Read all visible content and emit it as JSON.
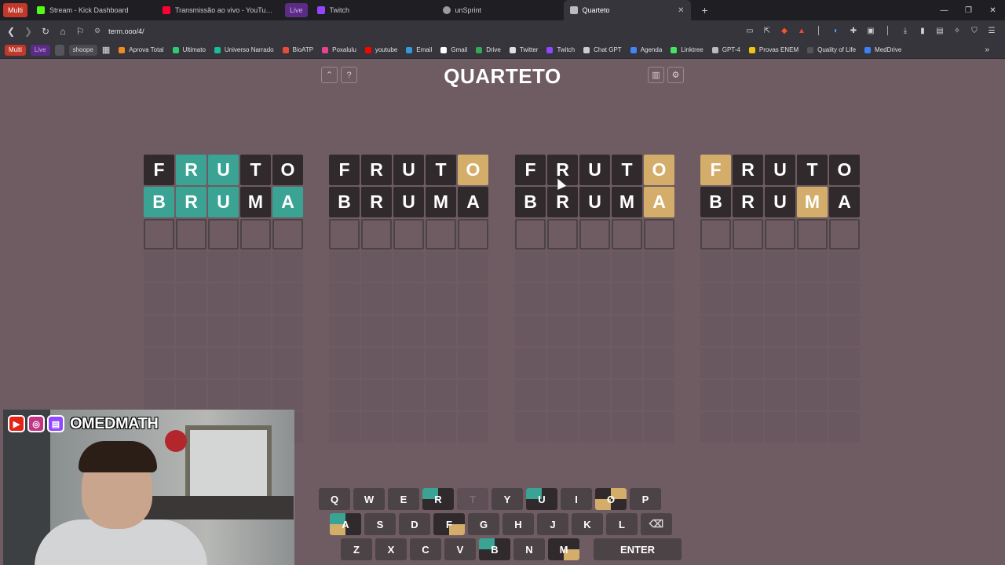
{
  "browser": {
    "multi_label": "Multi",
    "tabs": [
      {
        "label": "Stream - Kick Dashboard",
        "fav": "#53fc18"
      },
      {
        "label": "Transmissão ao vivo - YouTube Studio",
        "fav": "#ff0033"
      },
      {
        "label": "Twitch",
        "fav": "#9146ff"
      },
      {
        "label": "unSprint",
        "fav": "#9a9aa0"
      },
      {
        "label": "Quarteto",
        "fav": "#bbbbbb"
      }
    ],
    "live_label": "Live",
    "new_tab": "+",
    "url": "term.ooo/4/",
    "bookmarks_pills": [
      "Multi",
      "Live",
      "shoope"
    ],
    "bookmarks": [
      {
        "label": "Aprova Total",
        "color": "#f08a24"
      },
      {
        "label": "Ultimato",
        "color": "#2ecc71"
      },
      {
        "label": "Universo Narrado",
        "color": "#1abc9c"
      },
      {
        "label": "BioATP",
        "color": "#e74c3c"
      },
      {
        "label": "Poxalulu",
        "color": "#e84393"
      },
      {
        "label": "youtube",
        "color": "#ff0000"
      },
      {
        "label": "Email",
        "color": "#3498db"
      },
      {
        "label": "Gmail",
        "color": "#ffffff"
      },
      {
        "label": "Drive",
        "color": "#34a853"
      },
      {
        "label": "Twitter",
        "color": "#e0e0e0"
      },
      {
        "label": "Twitch",
        "color": "#9146ff"
      },
      {
        "label": "Chat GPT",
        "color": "#cccccc"
      },
      {
        "label": "Agenda",
        "color": "#4285f4"
      },
      {
        "label": "Linktree",
        "color": "#43e55e"
      },
      {
        "label": "GPT-4",
        "color": "#bbbbbb"
      },
      {
        "label": "Provas ENEM",
        "color": "#f1c40f"
      },
      {
        "label": "Quality of Life",
        "color": "#555555"
      },
      {
        "label": "MedDrive",
        "color": "#3b82f6"
      }
    ]
  },
  "game": {
    "title": "QUARTETO",
    "boards": [
      {
        "rows": [
          [
            [
              "F",
              "w"
            ],
            [
              "R",
              "g"
            ],
            [
              "U",
              "g"
            ],
            [
              "T",
              "w"
            ],
            [
              "O",
              "w"
            ]
          ],
          [
            [
              "B",
              "g"
            ],
            [
              "R",
              "g"
            ],
            [
              "U",
              "g"
            ],
            [
              "M",
              "w"
            ],
            [
              "A",
              "g"
            ]
          ]
        ]
      },
      {
        "rows": [
          [
            [
              "F",
              "w"
            ],
            [
              "R",
              "w"
            ],
            [
              "U",
              "w"
            ],
            [
              "T",
              "w"
            ],
            [
              "O",
              "y"
            ]
          ],
          [
            [
              "B",
              "w"
            ],
            [
              "R",
              "w"
            ],
            [
              "U",
              "w"
            ],
            [
              "M",
              "w"
            ],
            [
              "A",
              "w"
            ]
          ]
        ]
      },
      {
        "rows": [
          [
            [
              "F",
              "w"
            ],
            [
              "R",
              "w"
            ],
            [
              "U",
              "w"
            ],
            [
              "T",
              "w"
            ],
            [
              "O",
              "y"
            ]
          ],
          [
            [
              "B",
              "w"
            ],
            [
              "R",
              "w"
            ],
            [
              "U",
              "w"
            ],
            [
              "M",
              "w"
            ],
            [
              "A",
              "y"
            ]
          ]
        ]
      },
      {
        "rows": [
          [
            [
              "F",
              "y"
            ],
            [
              "R",
              "w"
            ],
            [
              "U",
              "w"
            ],
            [
              "T",
              "w"
            ],
            [
              "O",
              "w"
            ]
          ],
          [
            [
              "B",
              "w"
            ],
            [
              "R",
              "w"
            ],
            [
              "U",
              "w"
            ],
            [
              "M",
              "y"
            ],
            [
              "A",
              "w"
            ]
          ]
        ]
      }
    ],
    "keyboard": [
      [
        {
          "k": "Q"
        },
        {
          "k": "W"
        },
        {
          "k": "E"
        },
        {
          "k": "R",
          "q": [
            "g",
            "d",
            "d",
            "d"
          ]
        },
        {
          "k": "T",
          "used": true
        },
        {
          "k": "Y"
        },
        {
          "k": "U",
          "q": [
            "g",
            "d",
            "d",
            "d"
          ]
        },
        {
          "k": "I"
        },
        {
          "k": "O",
          "q": [
            "d",
            "y",
            "y",
            "d"
          ]
        },
        {
          "k": "P"
        }
      ],
      [
        {
          "k": "A",
          "q": [
            "g",
            "d",
            "y",
            "d"
          ]
        },
        {
          "k": "S"
        },
        {
          "k": "D"
        },
        {
          "k": "F",
          "q": [
            "d",
            "d",
            "d",
            "y"
          ]
        },
        {
          "k": "G"
        },
        {
          "k": "H"
        },
        {
          "k": "J"
        },
        {
          "k": "K"
        },
        {
          "k": "L"
        },
        {
          "k": "⌫",
          "special": "backspace"
        }
      ],
      [
        {
          "k": "Z"
        },
        {
          "k": "X"
        },
        {
          "k": "C"
        },
        {
          "k": "V"
        },
        {
          "k": "B",
          "q": [
            "g",
            "d",
            "d",
            "d"
          ]
        },
        {
          "k": "N"
        },
        {
          "k": "M",
          "q": [
            "d",
            "d",
            "d",
            "y"
          ]
        },
        {
          "k": "ENTER",
          "special": "enter"
        }
      ]
    ]
  },
  "webcam": {
    "channel": "OMEDMATH"
  }
}
